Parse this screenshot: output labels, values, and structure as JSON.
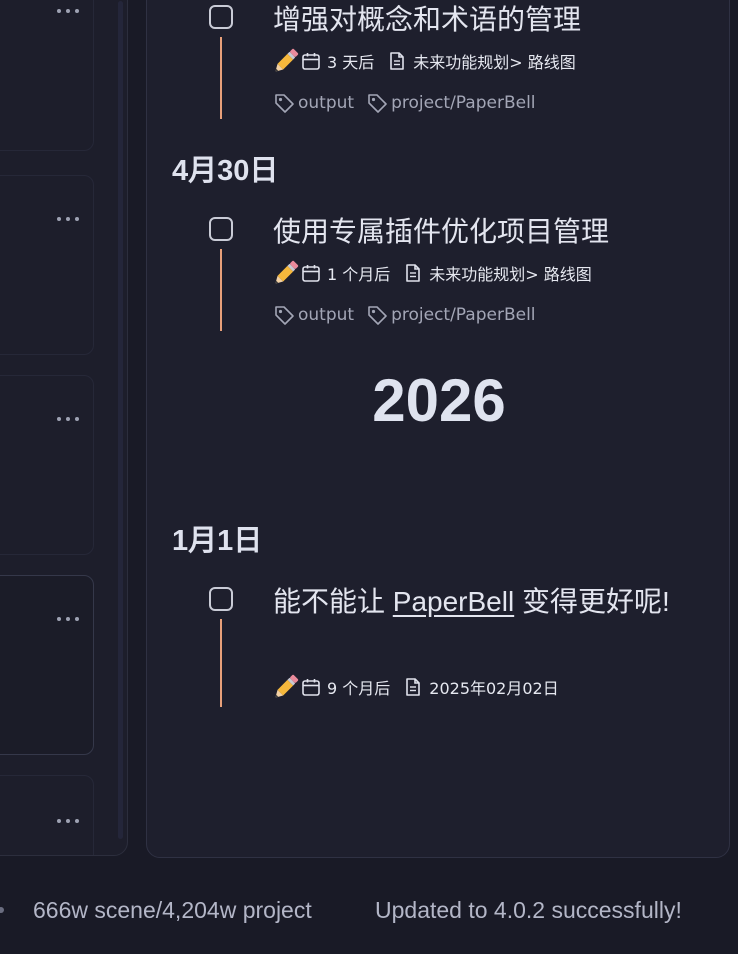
{
  "tasks": [
    {
      "title": "增强对概念和术语的管理",
      "due": "3 天后",
      "source": "未来功能规划> 路线图",
      "tags": [
        "output",
        "project/PaperBell"
      ]
    },
    {
      "title": "使用专属插件优化项目管理",
      "due": "1 个月后",
      "source": "未来功能规划> 路线图",
      "tags": [
        "output",
        "project/PaperBell"
      ]
    },
    {
      "title_before": "能不能让 ",
      "title_link": "PaperBell",
      "title_after": " 变得更好呢!",
      "due": "9 个月后",
      "source": "2025年02月02日"
    }
  ],
  "headings": {
    "date_1": "4月30日",
    "year": "2026",
    "date_2": "1月1日"
  },
  "status": {
    "word_count": "666w scene/4,204w project",
    "update_message": "Updated to 4.0.2 successfully!"
  },
  "colors": {
    "background": "#191a26",
    "panel": "#1e1f2d",
    "timeline_accent": "#e8a07a",
    "tag_text": "#a3a6b6"
  },
  "icons": {
    "task_priority": "pencil-icon",
    "due_date": "calendar-icon",
    "source_file": "document-icon",
    "tag": "tag-icon",
    "card_menu": "more-horizontal-icon"
  }
}
